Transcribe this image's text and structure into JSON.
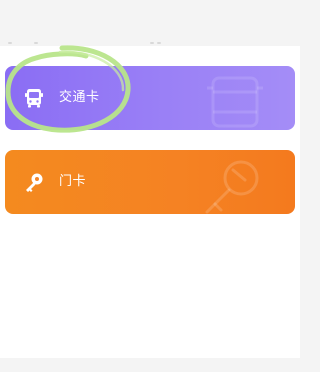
{
  "cards": [
    {
      "label": "交通卡",
      "icon": "bus-icon",
      "accent": "#8a6df4"
    },
    {
      "label": "门卡",
      "icon": "key-icon",
      "accent": "#f48a1f"
    }
  ],
  "annotation": {
    "color": "#b8e58a"
  }
}
